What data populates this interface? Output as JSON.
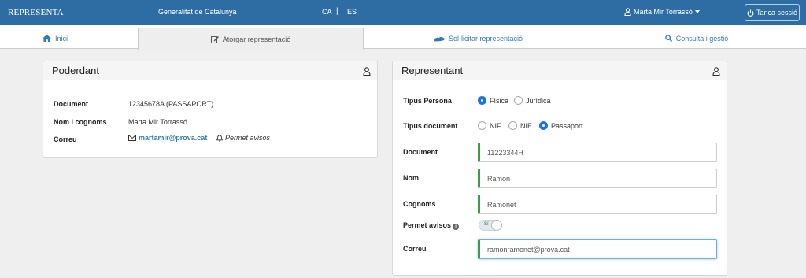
{
  "header": {
    "brand": "REPRESENTA",
    "organization": "Generalitat de Catalunya",
    "lang_ca": "CA",
    "lang_separator": "|",
    "lang_es": "ES",
    "user_name": "Marta Mir Torrassó",
    "logout_label": "Tanca sessió"
  },
  "nav": {
    "tabs": [
      {
        "label": "Inici",
        "icon": "home-icon"
      },
      {
        "label": "Atorgar representació",
        "icon": "edit-icon",
        "active": true
      },
      {
        "label": "Sol·licitar representació",
        "icon": "handshake-icon"
      },
      {
        "label": "Consulta i gestió",
        "icon": "search-icon"
      }
    ]
  },
  "poderdant": {
    "title": "Poderdant",
    "document_label": "Document",
    "document_value": "12345678A (PASSAPORT)",
    "name_label": "Nom i cognoms",
    "name_value": "Marta Mir Torrassó",
    "email_label": "Correu",
    "email_value": "martamir@prova.cat",
    "notify_label": "Permet avisos"
  },
  "representant": {
    "title": "Representant",
    "person_type_label": "Tipus Persona",
    "person_type_options": [
      "Física",
      "Jurídica"
    ],
    "person_type_selected": "Física",
    "doc_type_label": "Tipus document",
    "doc_type_options": [
      "NIF",
      "NIE",
      "Passaport"
    ],
    "doc_type_selected": "Passaport",
    "document_label": "Document",
    "document_value": "11223344H",
    "name_label": "Nom",
    "name_value": "Ramon",
    "surname_label": "Cognoms",
    "surname_value": "Ramonet",
    "notify_label": "Permet avisos",
    "notify_toggle_text": "Sí",
    "notify_enabled": true,
    "email_label": "Correu",
    "email_value": "ramonramonet@prova.cat"
  },
  "colors": {
    "header_bg": "#2e6da4",
    "link": "#337ab7",
    "radio_selected": "#1a73e8",
    "input_accent": "#3c9d48"
  }
}
